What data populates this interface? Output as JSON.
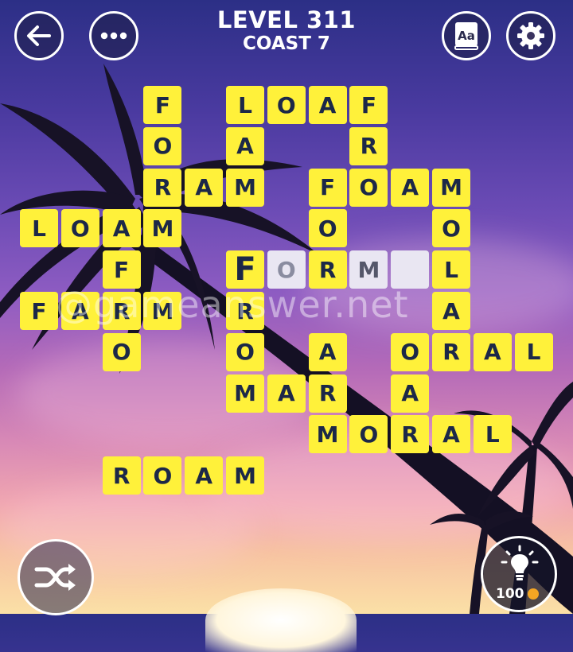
{
  "header": {
    "level_title": "LEVEL 311",
    "level_subtitle": "COAST 7"
  },
  "icons": {
    "back": "back-arrow-icon",
    "menu": "more-dots-icon",
    "dictionary": "dictionary-book-icon",
    "dictionary_label": "Aa",
    "settings": "gear-icon",
    "shuffle": "shuffle-icon",
    "hint": "lightbulb-icon",
    "coin": "coin-icon"
  },
  "hint": {
    "count": "100"
  },
  "watermark": "@gameanswer.net",
  "colors": {
    "tile": "#fff13a",
    "tile_text": "#1c2848",
    "empty_tile": "#e9e6f2",
    "coin": "#f5a623"
  },
  "board": {
    "cols": 13,
    "rows": 10,
    "cells": [
      {
        "r": 0,
        "c": 3,
        "ch": "F"
      },
      {
        "r": 0,
        "c": 5,
        "ch": "L"
      },
      {
        "r": 0,
        "c": 6,
        "ch": "O"
      },
      {
        "r": 0,
        "c": 7,
        "ch": "A"
      },
      {
        "r": 0,
        "c": 8,
        "ch": "F"
      },
      {
        "r": 1,
        "c": 3,
        "ch": "O"
      },
      {
        "r": 1,
        "c": 5,
        "ch": "A"
      },
      {
        "r": 1,
        "c": 8,
        "ch": "R"
      },
      {
        "r": 2,
        "c": 3,
        "ch": "R"
      },
      {
        "r": 2,
        "c": 4,
        "ch": "A"
      },
      {
        "r": 2,
        "c": 5,
        "ch": "M"
      },
      {
        "r": 2,
        "c": 7,
        "ch": "F"
      },
      {
        "r": 2,
        "c": 8,
        "ch": "O"
      },
      {
        "r": 2,
        "c": 9,
        "ch": "A"
      },
      {
        "r": 2,
        "c": 10,
        "ch": "M"
      },
      {
        "r": 3,
        "c": 0,
        "ch": "L"
      },
      {
        "r": 3,
        "c": 1,
        "ch": "O"
      },
      {
        "r": 3,
        "c": 2,
        "ch": "A"
      },
      {
        "r": 3,
        "c": 3,
        "ch": "M"
      },
      {
        "r": 3,
        "c": 7,
        "ch": "O"
      },
      {
        "r": 3,
        "c": 10,
        "ch": "O"
      },
      {
        "r": 4,
        "c": 2,
        "ch": "F"
      },
      {
        "r": 4,
        "c": 5,
        "ch": "F",
        "big": true
      },
      {
        "r": 4,
        "c": 6,
        "ch": "O",
        "empty": true
      },
      {
        "r": 4,
        "c": 7,
        "ch": "R"
      },
      {
        "r": 4,
        "c": 8,
        "ch": "M",
        "empty": true
      },
      {
        "r": 4,
        "c": 9,
        "ch": "",
        "empty": true
      },
      {
        "r": 4,
        "c": 10,
        "ch": "L"
      },
      {
        "r": 5,
        "c": 0,
        "ch": "F"
      },
      {
        "r": 5,
        "c": 1,
        "ch": "A"
      },
      {
        "r": 5,
        "c": 2,
        "ch": "R"
      },
      {
        "r": 5,
        "c": 3,
        "ch": "M"
      },
      {
        "r": 5,
        "c": 5,
        "ch": "R"
      },
      {
        "r": 5,
        "c": 10,
        "ch": "A"
      },
      {
        "r": 6,
        "c": 2,
        "ch": "O"
      },
      {
        "r": 6,
        "c": 5,
        "ch": "O"
      },
      {
        "r": 6,
        "c": 7,
        "ch": "A"
      },
      {
        "r": 6,
        "c": 9,
        "ch": "O"
      },
      {
        "r": 6,
        "c": 10,
        "ch": "R"
      },
      {
        "r": 6,
        "c": 11,
        "ch": "A"
      },
      {
        "r": 6,
        "c": 12,
        "ch": "L"
      },
      {
        "r": 7,
        "c": 5,
        "ch": "M"
      },
      {
        "r": 7,
        "c": 6,
        "ch": "A"
      },
      {
        "r": 7,
        "c": 7,
        "ch": "R"
      },
      {
        "r": 7,
        "c": 9,
        "ch": "A"
      },
      {
        "r": 8,
        "c": 7,
        "ch": "M"
      },
      {
        "r": 8,
        "c": 8,
        "ch": "O"
      },
      {
        "r": 8,
        "c": 9,
        "ch": "R"
      },
      {
        "r": 8,
        "c": 10,
        "ch": "A"
      },
      {
        "r": 8,
        "c": 11,
        "ch": "L"
      },
      {
        "r": 9,
        "c": 2,
        "ch": "R"
      },
      {
        "r": 9,
        "c": 3,
        "ch": "O"
      },
      {
        "r": 9,
        "c": 4,
        "ch": "A"
      },
      {
        "r": 9,
        "c": 5,
        "ch": "M"
      }
    ]
  }
}
